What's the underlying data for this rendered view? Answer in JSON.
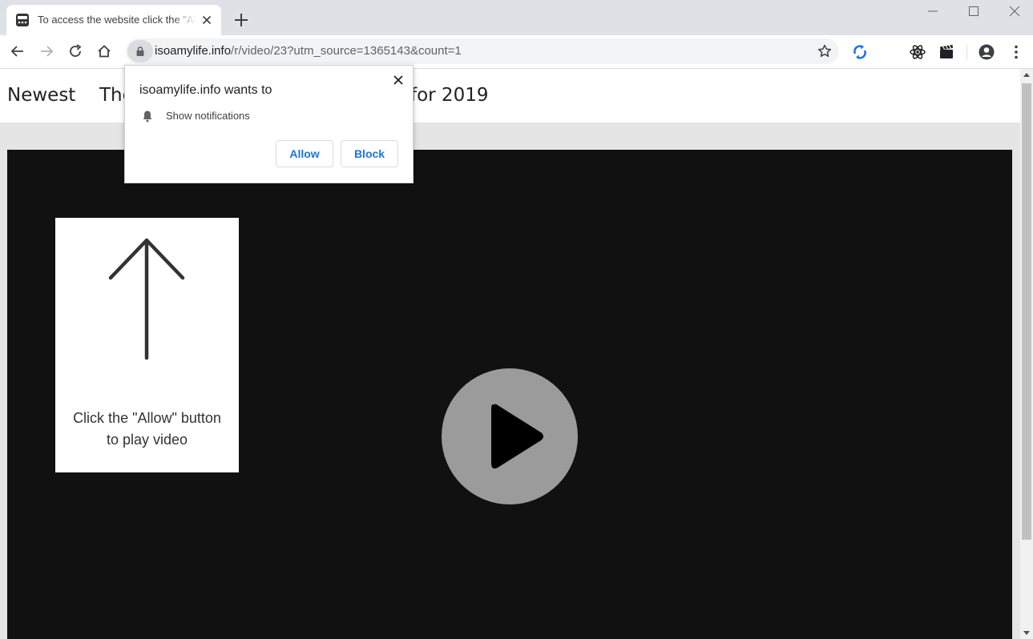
{
  "browser": {
    "tab": {
      "title": "To access the website click the \"Allow\" button",
      "favicon": "video-player-icon"
    },
    "address": {
      "host": "isoamylife.info",
      "path": "/r/video/23?utm_source=1365143&count=1"
    },
    "extensions": [
      "sync-extension-icon",
      "atom-extension-icon",
      "clapperboard-extension-icon"
    ],
    "colors": {
      "link_blue": "#1a73e8",
      "tabstrip": "#dee1e6"
    }
  },
  "page": {
    "nav": {
      "item1": "Newest",
      "item2": "The",
      "item3": "for 2019"
    },
    "hint": {
      "line1": "Click the \"Allow\" button",
      "line2": "to play video"
    }
  },
  "permission": {
    "title": "isoamylife.info wants to",
    "item": "Show notifications",
    "allow": "Allow",
    "block": "Block"
  }
}
